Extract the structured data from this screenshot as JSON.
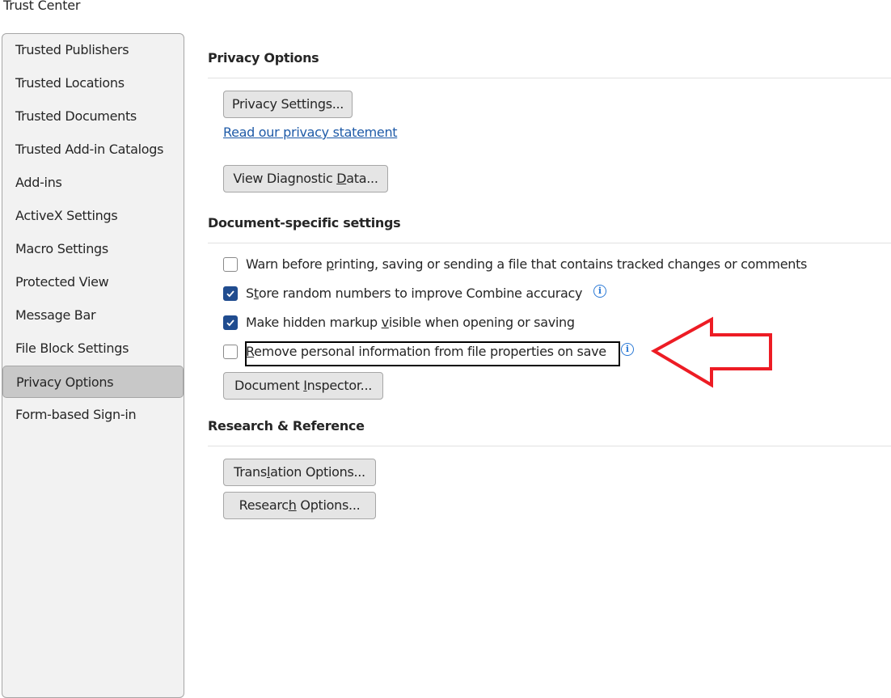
{
  "window": {
    "title": "Trust Center"
  },
  "sidebar": {
    "items": [
      {
        "label": "Trusted Publishers",
        "selected": false
      },
      {
        "label": "Trusted Locations",
        "selected": false
      },
      {
        "label": "Trusted Documents",
        "selected": false
      },
      {
        "label": "Trusted Add-in Catalogs",
        "selected": false
      },
      {
        "label": "Add-ins",
        "selected": false
      },
      {
        "label": "ActiveX Settings",
        "selected": false
      },
      {
        "label": "Macro Settings",
        "selected": false
      },
      {
        "label": "Protected View",
        "selected": false
      },
      {
        "label": "Message Bar",
        "selected": false
      },
      {
        "label": "File Block Settings",
        "selected": false
      },
      {
        "label": "Privacy Options",
        "selected": true
      },
      {
        "label": "Form-based Sign-in",
        "selected": false
      }
    ]
  },
  "privacy": {
    "title": "Privacy Options",
    "settings_button": "Privacy Settings...",
    "statement_link": "Read our privacy statement",
    "diagnostic_button": {
      "pre": "View Diagnostic ",
      "accel": "D",
      "post": "ata..."
    }
  },
  "document": {
    "title": "Document-specific settings",
    "checkboxes": [
      {
        "pre": "Warn before ",
        "accel": "p",
        "post": "rinting, saving or sending a file that contains tracked changes or comments",
        "checked": false,
        "info": false
      },
      {
        "pre": "S",
        "accel": "t",
        "post": "ore random numbers to improve Combine accuracy",
        "checked": true,
        "info": true
      },
      {
        "pre": "Make hidden markup ",
        "accel": "v",
        "post": "isible when opening or saving",
        "checked": true,
        "info": false
      },
      {
        "pre": "",
        "accel": "R",
        "post": "emove personal information from file properties on save",
        "checked": false,
        "info": true,
        "focused": true
      }
    ],
    "inspector_button": {
      "pre": "Document ",
      "accel": "I",
      "post": "nspector..."
    }
  },
  "research": {
    "title": "Research & Reference",
    "translation_button": {
      "pre": "Trans",
      "accel": "l",
      "post": "ation Options..."
    },
    "research_button": {
      "pre": "Researc",
      "accel": "h",
      "post": " Options..."
    }
  },
  "annotation": {
    "arrow_color": "#ed1c24",
    "arrow_direction": "left"
  }
}
